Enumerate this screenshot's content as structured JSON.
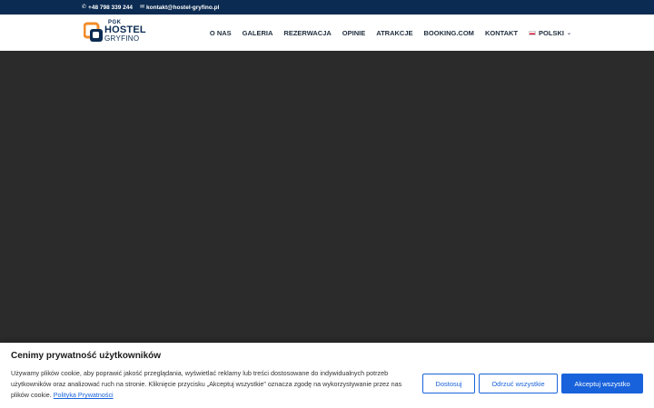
{
  "topbar": {
    "phone": "+48 798 339 244",
    "email": "kontakt@hostel-gryfino.pl",
    "phone_icon": "phone-icon",
    "email_icon": "envelope-icon"
  },
  "logo": {
    "line1": "PGK",
    "line2": "HOSTEL",
    "line3": "GRYFINO"
  },
  "nav": {
    "items": [
      "O NAS",
      "GALERIA",
      "REZERWACJA",
      "OPINIE",
      "ATRAKCJE",
      "BOOKING.COM",
      "KONTAKT"
    ],
    "language": "POLSKI"
  },
  "cookie": {
    "title": "Cenimy prywatność użytkowników",
    "text": "Używamy plików cookie, aby poprawić jakość przeglądania, wyświetlać reklamy lub treści dostosowane do indywidualnych potrzeb użytkowników oraz analizować ruch na stronie. Kliknięcie przycisku „Akceptuj wszystkie” oznacza zgodę na wykorzystywanie przez nas plików cookie.",
    "link": "Polityka Prywatności",
    "customize": "Dostosuj",
    "reject": "Odrzuć wszystkie",
    "accept": "Akceptuj wszystko"
  },
  "colors": {
    "topbar": "#0b2b52",
    "accent": "#1863dc",
    "logo_orange": "#f28c28"
  }
}
